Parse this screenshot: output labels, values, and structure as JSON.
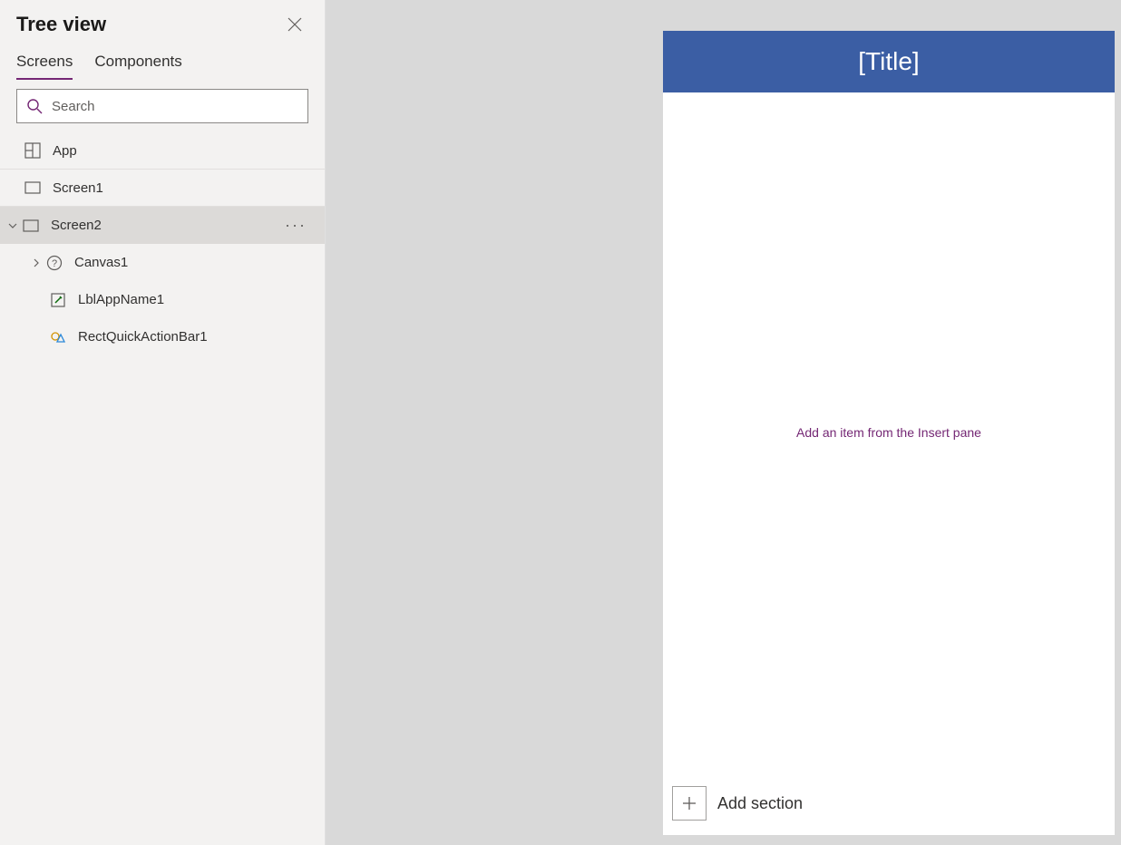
{
  "panel": {
    "title": "Tree view",
    "tabs": {
      "screens": "Screens",
      "components": "Components"
    },
    "search_placeholder": "Search"
  },
  "tree": {
    "app": "App",
    "screen1": "Screen1",
    "screen2": "Screen2",
    "canvas1": "Canvas1",
    "lblAppName1": "LblAppName1",
    "rectQuickActionBar1": "RectQuickActionBar1"
  },
  "canvas": {
    "title": "[Title]",
    "hint": "Add an item from the Insert pane",
    "add_section": "Add section"
  }
}
